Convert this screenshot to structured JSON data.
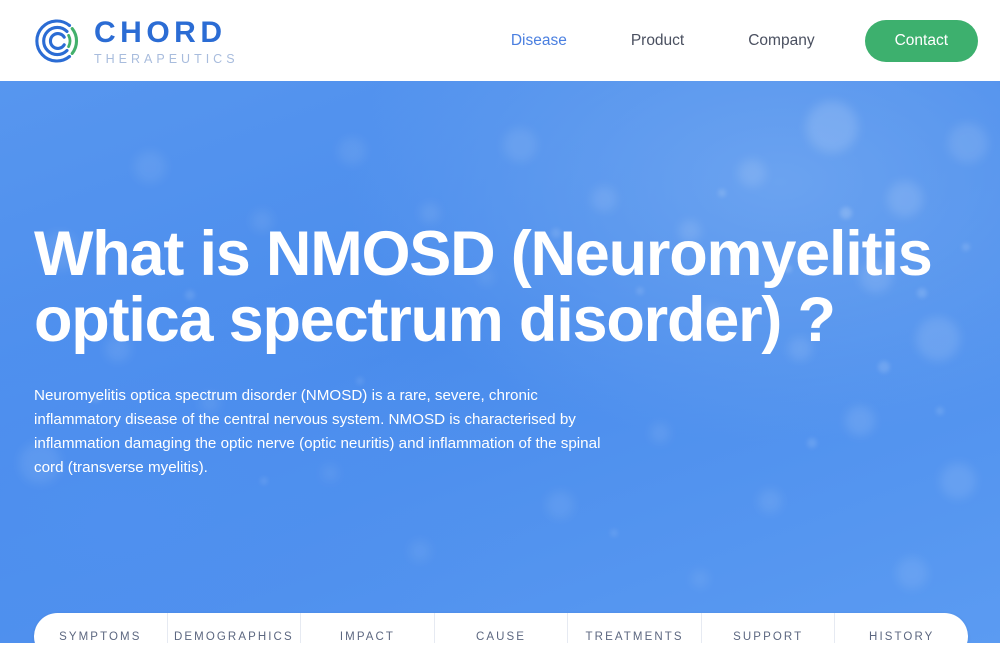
{
  "header": {
    "logo": {
      "icon": "chord-circular-logo",
      "wordmark_main": "CHORD",
      "wordmark_sub": "THERAPEUTICS",
      "brand_blue": "#2b6cd4",
      "brand_subtle": "#a8bcdd",
      "accent_green": "#3db06e"
    },
    "nav": [
      {
        "label": "Disease",
        "active": true
      },
      {
        "label": "Product",
        "active": false
      },
      {
        "label": "Company",
        "active": false
      }
    ],
    "cta": {
      "label": "Contact",
      "color": "#3db06e"
    }
  },
  "hero": {
    "title": "What is NMOSD (Neuromyelitis optica spectrum disorder) ?",
    "description": "Neuromyelitis optica spectrum disorder (NMOSD) is a rare, severe, chronic inflammatory disease of the central nervous system. NMOSD is characterised by inflammation damaging the optic nerve (optic neuritis) and inflammation of the spinal cord (transverse myelitis).",
    "background_color": "#4a8cec",
    "text_color": "#ffffff"
  },
  "tabs": [
    {
      "label": "SYMPTOMS"
    },
    {
      "label": "DEMOGRAPHICS"
    },
    {
      "label": "IMPACT"
    },
    {
      "label": "CAUSE"
    },
    {
      "label": "TREATMENTS"
    },
    {
      "label": "SUPPORT"
    },
    {
      "label": "HISTORY"
    }
  ]
}
